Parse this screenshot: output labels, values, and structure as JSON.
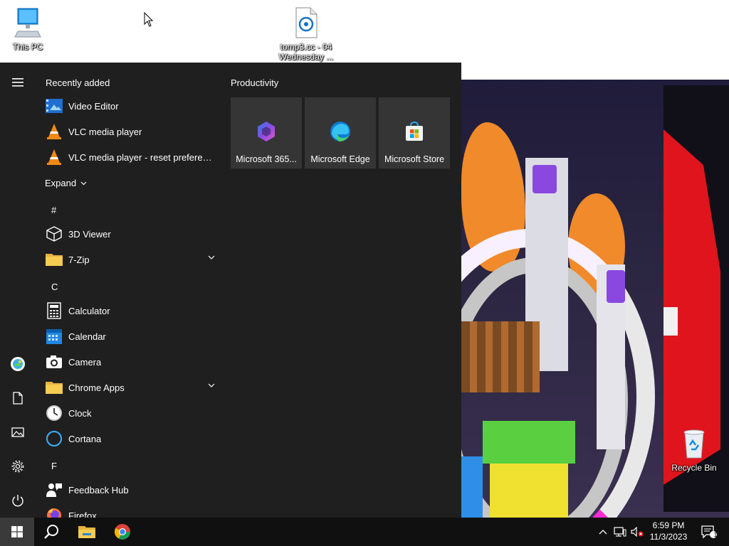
{
  "desktop": {
    "icons": [
      {
        "label": "This PC"
      },
      {
        "label": "tomp3.cc - 04 Wednesday ..."
      },
      {
        "label": "Recycle Bin"
      }
    ]
  },
  "start_menu": {
    "recently_added_title": "Recently added",
    "recent": [
      {
        "label": "Video Editor",
        "icon": "video-editor-icon"
      },
      {
        "label": "VLC media player",
        "icon": "vlc-icon"
      },
      {
        "label": "VLC media player - reset preferences...",
        "icon": "vlc-icon"
      }
    ],
    "expand_label": "Expand",
    "groups": [
      {
        "letter": "#"
      },
      {
        "letter": "C"
      },
      {
        "letter": "F"
      }
    ],
    "apps": [
      {
        "label": "3D Viewer",
        "icon": "3d-viewer-icon"
      },
      {
        "label": "7-Zip",
        "icon": "folder-icon"
      },
      {
        "label": "Calculator",
        "icon": "calculator-icon"
      },
      {
        "label": "Calendar",
        "icon": "calendar-icon"
      },
      {
        "label": "Camera",
        "icon": "camera-icon"
      },
      {
        "label": "Chrome Apps",
        "icon": "folder-icon"
      },
      {
        "label": "Clock",
        "icon": "clock-icon"
      },
      {
        "label": "Cortana",
        "icon": "cortana-icon"
      },
      {
        "label": "Feedback Hub",
        "icon": "feedback-hub-icon"
      },
      {
        "label": "Firefox",
        "icon": "firefox-icon"
      }
    ],
    "tiles_group_title": "Productivity",
    "tiles": [
      {
        "label": "Microsoft 365...",
        "icon": "microsoft-365-icon"
      },
      {
        "label": "Microsoft Edge",
        "icon": "edge-icon"
      },
      {
        "label": "Microsoft Store",
        "icon": "store-icon"
      }
    ]
  },
  "taskbar": {
    "time": "6:59 PM",
    "date": "11/3/2023",
    "notification_count": "1"
  },
  "colors": {
    "start_bg": "#1f1f1f",
    "tile_bg": "#353535",
    "taskbar_bg": "#101010",
    "accent_blue": "#0a84d8"
  }
}
